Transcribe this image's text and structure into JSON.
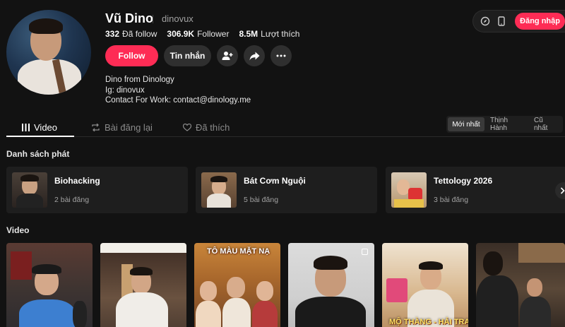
{
  "topbar": {
    "login_label": "Đăng nhập",
    "icons": [
      "compass-icon",
      "phone-icon"
    ]
  },
  "profile": {
    "name": "Vũ Dino",
    "handle": "dinovux",
    "stats": [
      {
        "value": "332",
        "label": "Đã follow"
      },
      {
        "value": "306.9K",
        "label": "Follower"
      },
      {
        "value": "8.5M",
        "label": "Lượt thích"
      }
    ],
    "follow_label": "Follow",
    "message_label": "Tin nhắn",
    "bio": [
      "Dino from Dinology",
      "Ig: dinovux",
      "Contact For Work: contact@dinology.me"
    ]
  },
  "tabs": [
    {
      "label": "Video",
      "icon": "grid-icon",
      "active": true
    },
    {
      "label": "Bài đăng lại",
      "icon": "repost-icon",
      "active": false
    },
    {
      "label": "Đã thích",
      "icon": "heart-icon",
      "active": false
    }
  ],
  "sort": [
    {
      "label": "Mới nhất",
      "active": true
    },
    {
      "label": "Thịnh Hành",
      "active": false
    },
    {
      "label": "Cũ nhất",
      "active": false
    }
  ],
  "playlist_section": {
    "title": "Danh sách phát",
    "items": [
      {
        "title": "Biohacking",
        "count": "2 bài đăng"
      },
      {
        "title": "Bát Cơm Nguội",
        "count": "5 bài đăng"
      },
      {
        "title": "Tettology 2026",
        "count": "3 bài đăng"
      }
    ]
  },
  "video_section": {
    "title": "Video",
    "captions": {
      "v3": "TÔ MÀU MẶT NẠ",
      "v5": "MỘ THÀNG - HẢI TRANG"
    }
  },
  "colors": {
    "accent": "#fe2c55",
    "background": "#121212",
    "surface": "#1e1e1e"
  }
}
